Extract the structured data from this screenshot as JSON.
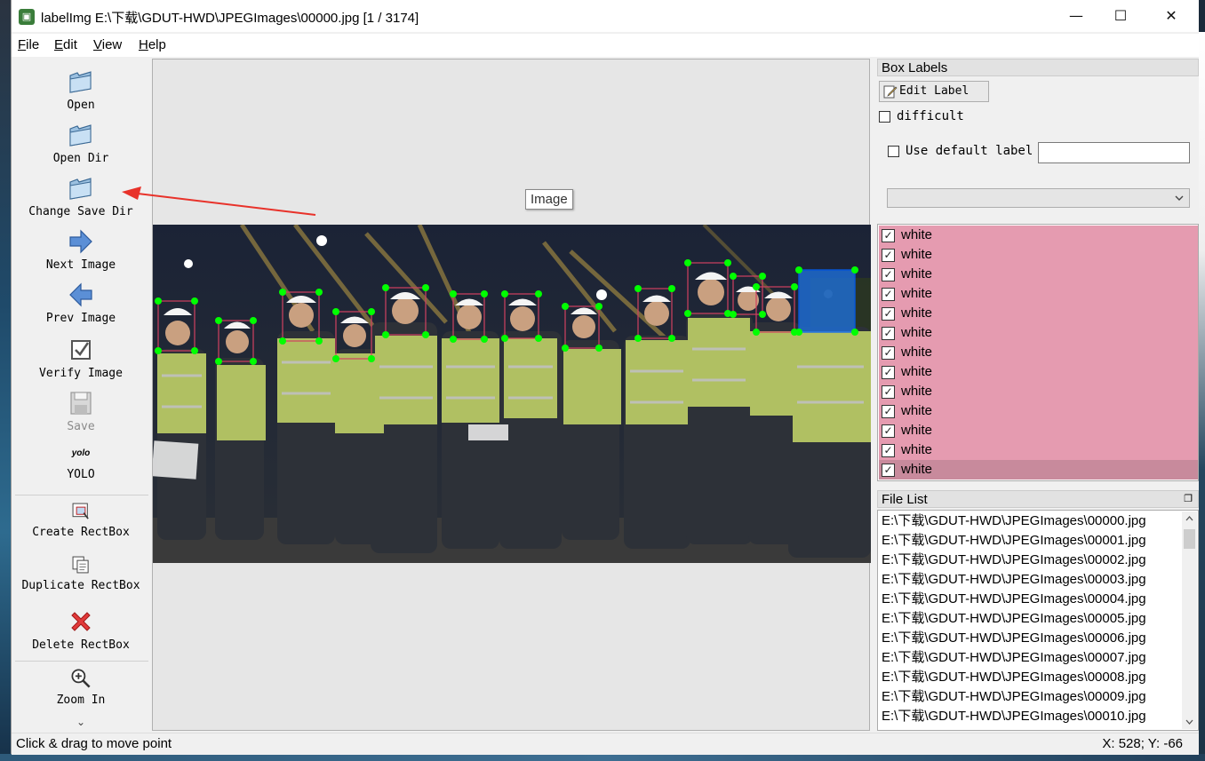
{
  "window": {
    "title": "labelImg E:\\下载\\GDUT-HWD\\JPEGImages\\00000.jpg [1 / 3174]",
    "minimize": "—",
    "maximize": "☐",
    "close": "✕"
  },
  "menu": [
    "File",
    "Edit",
    "View",
    "Help"
  ],
  "toolbar": {
    "open": "Open",
    "open_dir": "Open Dir",
    "change_save_dir": "Change Save Dir",
    "next_image": "Next Image",
    "prev_image": "Prev Image",
    "verify_image": "Verify Image",
    "save": "Save",
    "format_icon_text": "yolo",
    "format": "YOLO",
    "create_rectbox": "Create RectBox",
    "duplicate_rectbox": "Duplicate RectBox",
    "delete_rectbox": "Delete RectBox",
    "zoom_in": "Zoom In",
    "more": "⌄"
  },
  "canvas": {
    "tooltip": "Image"
  },
  "box_labels": {
    "title": "Box Labels",
    "edit_label": "Edit Label",
    "difficult": "difficult",
    "use_default_label": "Use default label",
    "default_label_value": "",
    "combo_value": "",
    "labels": [
      "white",
      "white",
      "white",
      "white",
      "white",
      "white",
      "white",
      "white",
      "white",
      "white",
      "white",
      "white",
      "white"
    ],
    "selected_index": 12
  },
  "file_list": {
    "title": "File List",
    "files": [
      "E:\\下载\\GDUT-HWD\\JPEGImages\\00000.jpg",
      "E:\\下载\\GDUT-HWD\\JPEGImages\\00001.jpg",
      "E:\\下载\\GDUT-HWD\\JPEGImages\\00002.jpg",
      "E:\\下载\\GDUT-HWD\\JPEGImages\\00003.jpg",
      "E:\\下载\\GDUT-HWD\\JPEGImages\\00004.jpg",
      "E:\\下载\\GDUT-HWD\\JPEGImages\\00005.jpg",
      "E:\\下载\\GDUT-HWD\\JPEGImages\\00006.jpg",
      "E:\\下载\\GDUT-HWD\\JPEGImages\\00007.jpg",
      "E:\\下载\\GDUT-HWD\\JPEGImages\\00008.jpg",
      "E:\\下载\\GDUT-HWD\\JPEGImages\\00009.jpg",
      "E:\\下载\\GDUT-HWD\\JPEGImages\\00010.jpg"
    ]
  },
  "status": {
    "message": "Click & drag to move point",
    "coords": "X: 528; Y: -66"
  },
  "colors": {
    "label_row": "#e59bb0",
    "label_row_selected": "#c88a9c",
    "box_point": "#00ff00",
    "box_selected_fill": "#1e6fd9",
    "arrow": "#e8322a"
  }
}
